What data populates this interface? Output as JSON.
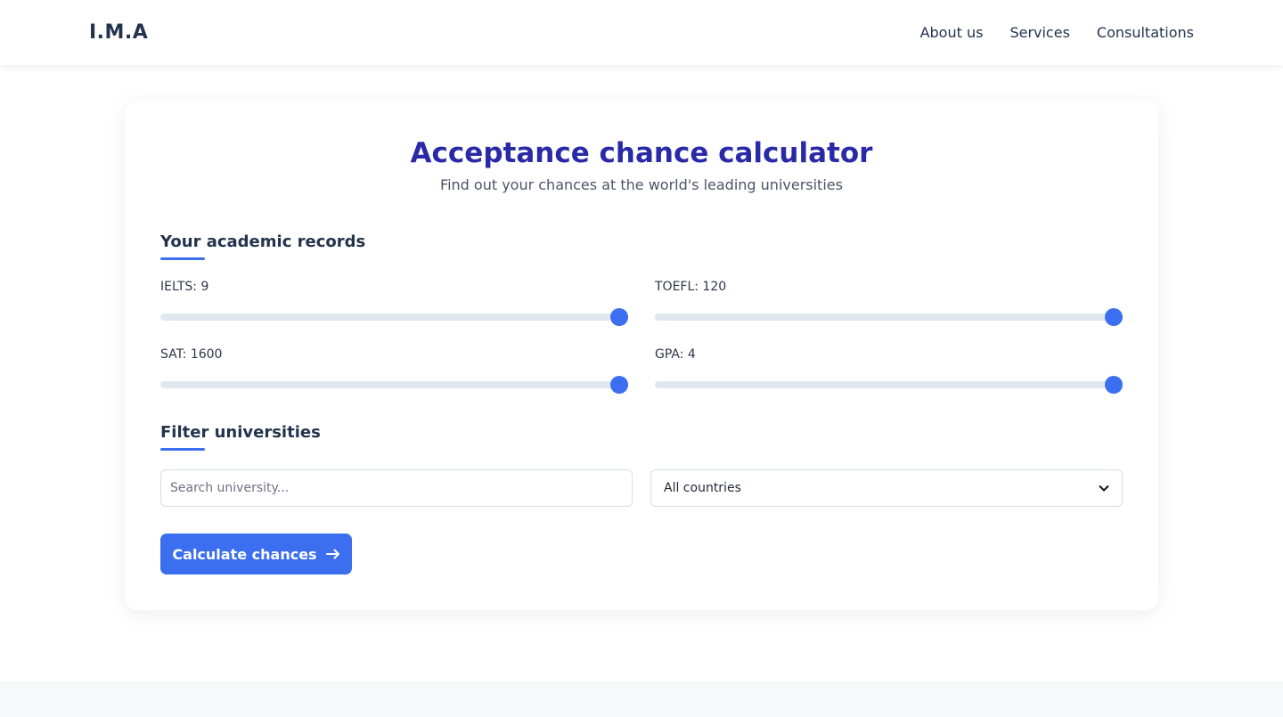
{
  "header": {
    "logo": "I.M.A",
    "nav": [
      {
        "label": "About us"
      },
      {
        "label": "Services"
      },
      {
        "label": "Consultations"
      }
    ]
  },
  "calculator": {
    "title": "Acceptance chance calculator",
    "subtitle": "Find out your chances at the world's leading universities",
    "records_title": "Your academic records",
    "sliders": [
      {
        "label": "IELTS: 9",
        "value": 9,
        "max": 9,
        "fraction": 1.0
      },
      {
        "label": "TOEFL: 120",
        "value": 120,
        "max": 120,
        "fraction": 1.0
      },
      {
        "label": "SAT: 1600",
        "value": 1600,
        "max": 1600,
        "fraction": 1.0
      },
      {
        "label": "GPA: 4",
        "value": 4,
        "max": 4,
        "fraction": 1.0
      }
    ],
    "filter_title": "Filter universities",
    "search": {
      "placeholder": "Search university...",
      "value": ""
    },
    "country_select": {
      "selected": "All countries"
    },
    "calculate_label": "Calculate chances",
    "arrow_icon": "arrow-right-icon"
  },
  "colors": {
    "accent": "#3b6ff0",
    "title": "#2a2aa8",
    "text_dark": "#23334d"
  }
}
